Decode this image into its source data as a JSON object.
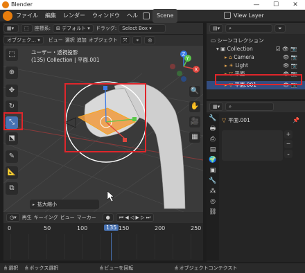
{
  "window": {
    "title": "Blender",
    "minimize": "—",
    "maximize": "☐",
    "close": "✕"
  },
  "menubar": {
    "items": [
      "ファイル",
      "編集",
      "レンダー",
      "ウィンドウ",
      "ヘル"
    ],
    "workspace_tab": "Scene",
    "view_layer": "View Layer"
  },
  "viewport_header": {
    "mode": "オブジェク…",
    "menus": [
      "ビュー",
      "選択",
      "追加",
      "オブジェクト"
    ],
    "orientation_label": "座標系:",
    "orientation_value": "デフォルト",
    "drag_label": "ドラッグ:",
    "drag_value": "Select Box"
  },
  "viewport": {
    "view_name": "ユーザー・透視投影",
    "collection_info": "(135) Collection | 平面.001",
    "last_op": "拡大縮小",
    "gizmo": {
      "z": "Z",
      "y": "Y",
      "x": "X"
    }
  },
  "outliner": {
    "title": "シーンコレクション",
    "rows": [
      {
        "name": "Collection",
        "indent": 1
      },
      {
        "name": "Camera",
        "indent": 2
      },
      {
        "name": "Light",
        "indent": 2
      },
      {
        "name": "平面",
        "indent": 2
      },
      {
        "name": "平面.001",
        "indent": 2
      }
    ]
  },
  "properties": {
    "object_name": "平面.001",
    "search_placeholder": ""
  },
  "timeline": {
    "menus": [
      "再生",
      "キーイング",
      "ビュー",
      "マーカー"
    ],
    "current_frame": "135",
    "ticks": [
      "0",
      "50",
      "100",
      "150",
      "200",
      "250"
    ]
  },
  "statusbar": {
    "select": "選択",
    "box_select": "ボックス選択",
    "rotate_view": "ビューを回転",
    "context": "オブジェクトコンテクスト"
  },
  "colors": {
    "accent": "#4772b3",
    "highlight": "#e0262b",
    "selected_origin": "#f5a623"
  }
}
